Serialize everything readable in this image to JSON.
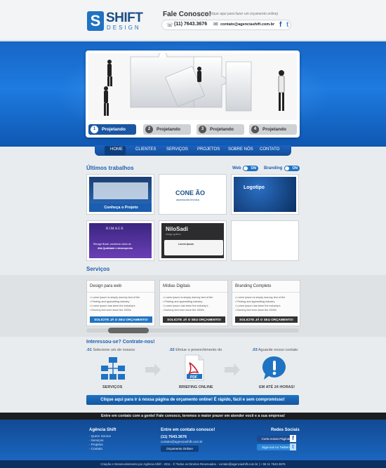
{
  "header": {
    "logo_letter": "S",
    "logo_title": "SHIFT",
    "logo_sub": "DESIGN",
    "contact_title": "Fale Conosco!",
    "contact_subtitle": "(ou clique aqui para fazer um orçamento online)",
    "phone": "(11) 7643.3676",
    "email": "contato@agenciashift.com.br",
    "social_fb": "f",
    "social_tw": "t"
  },
  "slider": {
    "tabs": [
      {
        "num": "1",
        "label": "Projetando"
      },
      {
        "num": "2",
        "label": "Projetando"
      },
      {
        "num": "3",
        "label": "Projetando"
      },
      {
        "num": "4",
        "label": "Projetando"
      }
    ]
  },
  "nav": {
    "items": [
      "HOME",
      "CLIENTES",
      "SERVIÇOS",
      "PROJETOS",
      "SOBRE NÓS",
      "CONTATO"
    ]
  },
  "works": {
    "title": "Últimos trabalhos",
    "toggle_web": "Web",
    "toggle_branding": "Branding",
    "toggle_on": "ON",
    "project_caption": "Conheça o Projeto",
    "conexao": "CONE  ÃO",
    "conexao_sub": "assessoria técnica",
    "logotipo": "Logotipo",
    "rimage": "RIMAGE",
    "rimage_text": "Rimage Brasil, vendendo robôs de",
    "rimage_text2": "Alta Qualidade e desempenho",
    "nilo": "NiloSadi",
    "nilo_sub": "design gráfico",
    "lorem_title": "Lorem Ipsum"
  },
  "services": {
    "title": "Serviços",
    "cards": [
      {
        "title": "Design para web",
        "button": "SOLICITE JÁ O SEU ORÇAMENTO!",
        "lines": [
          "• Lorem Ipsum is simply dummy text of the",
          "• Printing and typesetting industry",
          "• Lorem Ipsum has been the industry's",
          "• Dummy text ever since the 1500s"
        ]
      },
      {
        "title": "Mídias Digitais",
        "button": "SOLICITE JÁ O SEU ORÇAMENTO!",
        "lines": [
          "• Lorem Ipsum is simply dummy text of the",
          "• Printing and typesetting industry",
          "• Lorem Ipsum has been the industry's",
          "• Dummy text ever since the 1500s"
        ]
      },
      {
        "title": "Branding Completo",
        "button": "SOLICITE JÁ O SEU ORÇAMENTO!",
        "lines": [
          "• Lorem Ipsum is simply dummy text of the",
          "• Printing and typesetting industry",
          "• Lorem Ipsum has been the industry's",
          "• Dummy text ever since the 1500s"
        ]
      }
    ]
  },
  "process": {
    "title": "Interessou-se? Contrate-nos!",
    "steps": [
      {
        "num": ".01",
        "text": "Selecione um de nossos",
        "caption": "SERVIÇOS"
      },
      {
        "num": ".02",
        "text": "Efetue o preenchimento do",
        "caption": "BRIEFING ONLINE"
      },
      {
        "num": ".03",
        "text": "Aguarde nosso contato",
        "caption": "EM ATÉ 24 HORAS!"
      }
    ],
    "pdf_label": "PDF",
    "cta": "Clique aqui para ir à nossa página de orçamento online! É rápido, fácil e sem compromisso!"
  },
  "footer": {
    "banner": "Entre em contato com a gente! Fale conosco, teremos o maior prazer em atender você e a sua empresa!",
    "col1_title": "Agência Shift",
    "col1_links": [
      "- Quem Somos",
      "- Serviços",
      "- Projetos",
      "- Contato"
    ],
    "col2_title": "Entre em contato conosco!",
    "col2_phone": "(11) 7643.3676",
    "col2_email": "contato@agenciashift.com.br",
    "col2_button": "Orçamento Online!",
    "col3_title": "Redes Sociais",
    "fb_button": "Curta nossa Página!",
    "tw_button": "Siga-nos no Twitter!",
    "copyright": "Criação e Desenvolvimento por Agência Shift - 2011 - © Todos os Direitos Reservados - contato@agenciashift.com.br | + 55 11 7643.3676"
  },
  "colors": {
    "brand_blue": "#1f73c2",
    "dark_blue": "#1c4e86",
    "footer_dark": "#1b1d20"
  }
}
